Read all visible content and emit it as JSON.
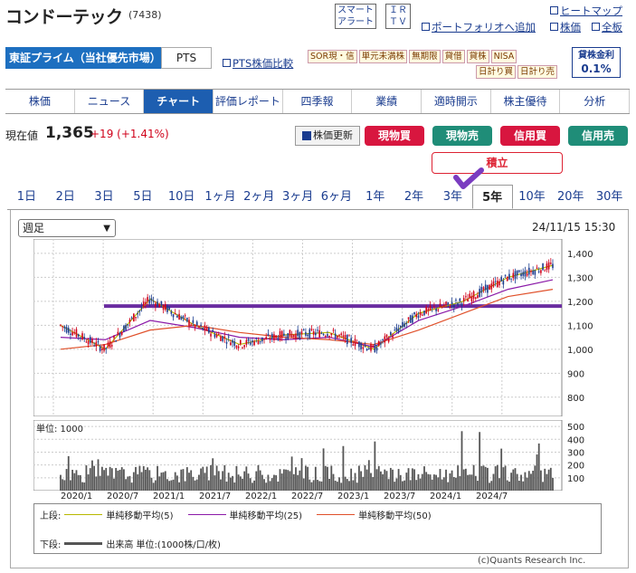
{
  "header": {
    "company_name": "コンドーテック",
    "code": "(7438)",
    "smart_alert_line1": "スマート",
    "smart_alert_line2": "アラート",
    "ir_line1": "ＩＲ",
    "ir_line2": "ＴＶ",
    "portfolio_link": "ポートフォリオへ追加",
    "heatmap_link": "ヒートマップ",
    "stock_link": "株価",
    "board_link": "全板"
  },
  "market": {
    "tab_label": "東証プライム（当社優先市場）",
    "pts_label": "PTS",
    "pts_compare_link": "PTS株価比較",
    "tags_row1": [
      "SOR現・信",
      "単元未満株",
      "無期限",
      "貸借",
      "貸株",
      "NISA"
    ],
    "tags_row2": [
      "日計り買",
      "日計り売"
    ],
    "lending_label": "貸株金利",
    "lending_rate": "0.1%"
  },
  "nav": {
    "tabs": [
      "株価",
      "ニュース",
      "チャート",
      "評価レポート",
      "四季報",
      "業績",
      "適時開示",
      "株主優待",
      "分析"
    ],
    "active_index": 2
  },
  "quote": {
    "label": "現在値",
    "price": "1,365",
    "change": "+19 (+1.41%)",
    "refresh_button": "株価更新",
    "buy_button": "現物買",
    "sell_button": "現物売",
    "margin_buy_button": "信用買",
    "margin_sell_button": "信用売",
    "tsumitate_button": "積立",
    "colors": {
      "buy": "#d8163f",
      "sell": "#1f8d78"
    }
  },
  "periods": {
    "items": [
      "1日",
      "2日",
      "3日",
      "5日",
      "10日",
      "1ヶ月",
      "2ヶ月",
      "3ヶ月",
      "6ヶ月",
      "1年",
      "2年",
      "3年",
      "5年",
      "10年",
      "20年",
      "30年"
    ],
    "active_index": 12
  },
  "chart_panel": {
    "interval_select": "週足",
    "timestamp": "24/11/15 15:30",
    "volume_unit": "単位: 1000",
    "copyright": "(c)Quants Research Inc."
  },
  "legend": {
    "upper_label": "上段:",
    "lower_label": "下段:",
    "ma5": "単純移動平均(5)",
    "ma25": "単純移動平均(25)",
    "ma50": "単純移動平均(50)",
    "volume": "出来高 単位:(1000株/口/枚)",
    "colors": {
      "ma5": "#b8b800",
      "ma25": "#8b1aa8",
      "ma50": "#e0502a",
      "support": "#6a2ca0"
    }
  },
  "chart_data": [
    {
      "type": "line",
      "title": "",
      "x": [
        "2020/1",
        "2020/7",
        "2021/1",
        "2021/7",
        "2022/1",
        "2022/7",
        "2023/1",
        "2023/7",
        "2024/1",
        "2024/7"
      ],
      "y_ticks": [
        800,
        900,
        1000,
        1100,
        1200,
        1300,
        1400
      ],
      "ylim": [
        720,
        1460
      ],
      "series": [
        {
          "name": "単純移動平均(5)",
          "values": [
            1100,
            1000,
            1210,
            1100,
            1020,
            1060,
            1070,
            1000,
            1150,
            1200,
            1300,
            1350
          ]
        },
        {
          "name": "単純移動平均(25)",
          "values": [
            1050,
            1040,
            1120,
            1090,
            1050,
            1040,
            1050,
            1010,
            1120,
            1180,
            1250,
            1290
          ]
        },
        {
          "name": "単純移動平均(50)",
          "values": [
            1000,
            1020,
            1080,
            1100,
            1070,
            1050,
            1040,
            1020,
            1080,
            1150,
            1220,
            1250
          ]
        }
      ],
      "support_line": 1180
    },
    {
      "type": "bar",
      "title": "",
      "ylabel": "単位: 1000",
      "y_ticks": [
        100,
        200,
        300,
        400,
        500
      ],
      "ylim": [
        0,
        550
      ]
    }
  ]
}
